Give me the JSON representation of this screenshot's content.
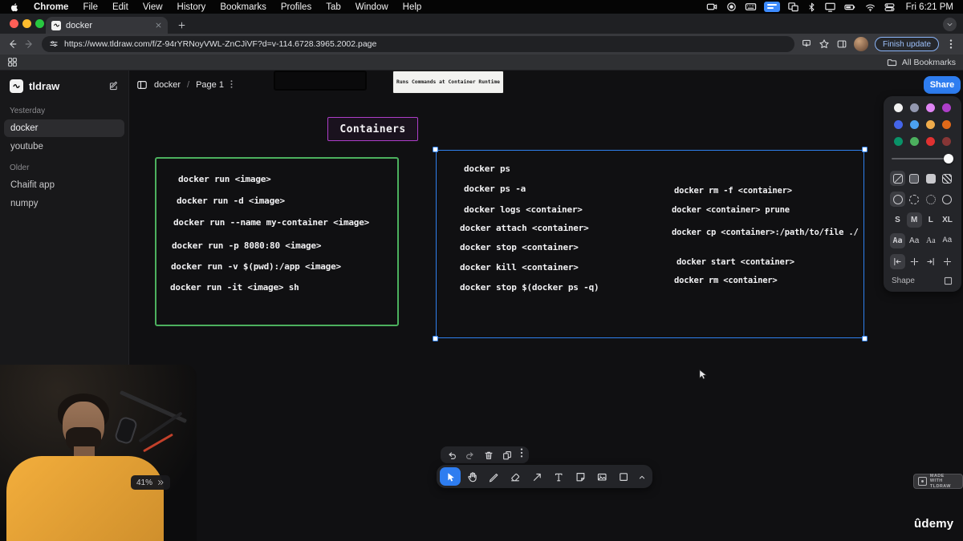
{
  "theme": {
    "accent_blue": "#2f80ed",
    "share_blue": "#2e7df0",
    "shape_green": "#4cb05e",
    "shape_violet": "#ae3ec9",
    "canvas_bg": "#101012"
  },
  "menubar": {
    "items": [
      "Chrome",
      "File",
      "Edit",
      "View",
      "History",
      "Bookmarks",
      "Profiles",
      "Tab",
      "Window",
      "Help"
    ],
    "clock": "Fri 6:21 PM"
  },
  "browser": {
    "tab_title": "docker",
    "url": "https://www.tldraw.com/f/Z-94rYRNoyVWL-ZnCJiVF?d=v-114.6728.3965.2002.page",
    "finish_update_label": "Finish update",
    "all_bookmarks_label": "All Bookmarks"
  },
  "sidebar": {
    "app_name": "tldraw",
    "sections": [
      {
        "label": "Yesterday",
        "items": [
          "docker",
          "youtube"
        ]
      },
      {
        "label": "Older",
        "items": [
          "Chaifit app",
          "numpy"
        ]
      }
    ]
  },
  "topbar": {
    "doc_name": "docker",
    "separator": "/",
    "page_name": "Page 1",
    "share_label": "Share"
  },
  "style_panel": {
    "colors": [
      "#f2f2f2",
      "#9398b0",
      "#e085f4",
      "#ae3ec9",
      "#4465e9",
      "#4ba1f1",
      "#f1ac4b",
      "#e16919",
      "#099268",
      "#4cb05e",
      "#e03131",
      "#873636"
    ],
    "sizes": [
      "S",
      "M",
      "L",
      "XL"
    ],
    "font_sample": "Aa",
    "shape_label": "Shape"
  },
  "canvas": {
    "note_top": "Runs Commands at Container Runtime",
    "section_title": "Containers",
    "run_commands": [
      "docker run <image>",
      "docker run -d <image>",
      "docker run --name my-container <image>",
      "docker run -p 8080:80 <image>",
      "docker run -v $(pwd):/app <image>",
      "docker run -it <image> sh"
    ],
    "ps_commands_left": [
      "docker ps",
      "docker ps -a",
      "docker logs <container>",
      "docker attach <container>",
      "docker stop <container>",
      "docker kill <container>",
      "docker stop $(docker ps -q)"
    ],
    "ps_commands_right": [
      "docker rm -f <container>",
      "docker <container> prune",
      "docker cp <container>:/path/to/file ./",
      "docker start <container>",
      "docker rm <container>"
    ]
  },
  "footer": {
    "zoom": "41%",
    "badge_line1": "MADE WITH",
    "badge_line2": "TLDRAW",
    "watermark": "ûdemy"
  }
}
